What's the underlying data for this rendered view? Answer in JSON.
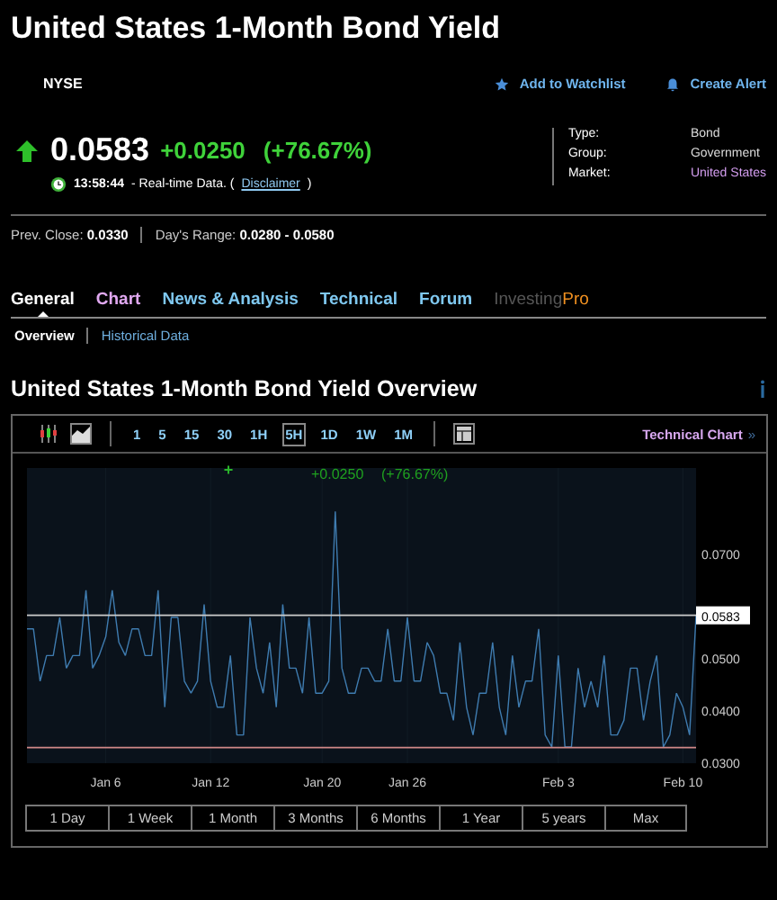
{
  "header": {
    "title": "United States 1-Month Bond Yield",
    "exchange": "NYSE",
    "actions": [
      {
        "kind": "watchlist",
        "label": "Add to Watchlist"
      },
      {
        "kind": "alert",
        "label": "Create Alert"
      }
    ]
  },
  "quote": {
    "price": "0.0583",
    "change": "+0.0250",
    "change_pct": "(+76.67%)",
    "time": "13:58:44",
    "status": "- Real-time Data. (",
    "disclaimer": "Disclaimer",
    "status_end": ")"
  },
  "info": [
    {
      "label": "Type:",
      "value": "Bond",
      "kind": "plain"
    },
    {
      "label": "Group:",
      "value": "Government",
      "kind": "plain"
    },
    {
      "label": "Market:",
      "value": "United States",
      "kind": "link"
    }
  ],
  "stats": [
    {
      "label": "Prev. Close:",
      "value": "0.0330"
    },
    {
      "label": "Day's Range:",
      "value": "0.0280 - 0.0580"
    }
  ],
  "tabs": [
    {
      "label": "General",
      "kind": "plain",
      "selected": true
    },
    {
      "label": "Chart",
      "kind": "chart",
      "selected": false
    },
    {
      "label": "News & Analysis",
      "kind": "plain",
      "selected": false
    },
    {
      "label": "Technical",
      "kind": "plain",
      "selected": false
    },
    {
      "label": "Forum",
      "kind": "plain",
      "selected": false
    },
    {
      "label": "Investing",
      "suffix": "Pro",
      "kind": "pro",
      "selected": false
    }
  ],
  "subtabs": [
    {
      "label": "Overview",
      "selected": true
    },
    {
      "label": "Historical Data",
      "selected": false
    }
  ],
  "overview": {
    "title": "United States 1-Month Bond Yield Overview",
    "toolbar": {
      "styles": [
        {
          "kind": "candles",
          "selected": false
        },
        {
          "kind": "area",
          "selected": true
        }
      ],
      "intervals": [
        {
          "label": "1",
          "selected": false
        },
        {
          "label": "5",
          "selected": false
        },
        {
          "label": "15",
          "selected": false
        },
        {
          "label": "30",
          "selected": false
        },
        {
          "label": "1H",
          "selected": false
        },
        {
          "label": "5H",
          "selected": true
        },
        {
          "label": "1D",
          "selected": false
        },
        {
          "label": "1W",
          "selected": false
        },
        {
          "label": "1M",
          "selected": false
        }
      ],
      "link": "Technical Chart",
      "link_arrow": "»"
    },
    "chart_header": {
      "marker": "+",
      "change": "+0.0250",
      "change_pct": "(+76.67%)"
    },
    "chart_data": {
      "type": "line",
      "ylim": [
        0.03,
        0.0865
      ],
      "yticks": [
        {
          "value": 0.03,
          "label": "0.0300"
        },
        {
          "value": 0.04,
          "label": "0.0400"
        },
        {
          "value": 0.05,
          "label": "0.0500"
        },
        {
          "value": 0.07,
          "label": "0.0700"
        }
      ],
      "categories": [
        null,
        null,
        null,
        null,
        null,
        null,
        null,
        null,
        null,
        null,
        null,
        null,
        "Jan 6",
        null,
        null,
        null,
        null,
        null,
        null,
        null,
        null,
        null,
        null,
        null,
        null,
        null,
        null,
        null,
        "Jan 12",
        null,
        null,
        null,
        null,
        null,
        null,
        null,
        null,
        null,
        null,
        null,
        null,
        null,
        null,
        null,
        null,
        "Jan 20",
        null,
        null,
        null,
        null,
        null,
        null,
        null,
        null,
        null,
        null,
        null,
        null,
        "Jan 26",
        null,
        null,
        null,
        null,
        null,
        null,
        null,
        null,
        null,
        null,
        null,
        null,
        null,
        null,
        null,
        null,
        null,
        null,
        null,
        null,
        null,
        null,
        "Feb 3",
        null,
        null,
        null,
        null,
        null,
        null,
        null,
        null,
        null,
        null,
        null,
        null,
        null,
        null,
        null,
        null,
        null,
        null,
        "Feb 10",
        null,
        null
      ],
      "series": [
        {
          "color": "#3f7cb0",
          "values": [
            0.0557,
            0.0557,
            0.0457,
            0.0506,
            0.0506,
            0.0579,
            0.0482,
            0.0506,
            0.0506,
            0.0631,
            0.0482,
            0.0506,
            0.0542,
            0.0631,
            0.0531,
            0.0506,
            0.0557,
            0.0557,
            0.0506,
            0.0506,
            0.0631,
            0.0407,
            0.0579,
            0.0579,
            0.0457,
            0.0434,
            0.0457,
            0.0604,
            0.0457,
            0.0407,
            0.0407,
            0.0506,
            0.0354,
            0.0354,
            0.0579,
            0.0482,
            0.0434,
            0.0531,
            0.0407,
            0.0604,
            0.0482,
            0.0482,
            0.0434,
            0.0579,
            0.0434,
            0.0434,
            0.0457,
            0.0782,
            0.0482,
            0.0434,
            0.0434,
            0.0482,
            0.0482,
            0.0457,
            0.0457,
            0.0557,
            0.0457,
            0.0457,
            0.0579,
            0.0457,
            0.0457,
            0.0531,
            0.0506,
            0.0434,
            0.0434,
            0.0382,
            0.0531,
            0.0407,
            0.0354,
            0.0434,
            0.0434,
            0.0531,
            0.0407,
            0.0354,
            0.0506,
            0.0407,
            0.0457,
            0.0457,
            0.0557,
            0.0354,
            0.0331,
            0.0506,
            0.0331,
            0.0331,
            0.0482,
            0.0407,
            0.0457,
            0.0407,
            0.0506,
            0.0354,
            0.0354,
            0.0382,
            0.0482,
            0.0482,
            0.0382,
            0.0457,
            0.0506,
            0.0331,
            0.0354,
            0.0434,
            0.0407,
            0.0354,
            0.0583
          ]
        }
      ],
      "grid": true,
      "ref_lines": [
        {
          "axis": "y",
          "value": 0.0583,
          "label": "0.0583",
          "color": "#cccccc"
        },
        {
          "axis": "y",
          "value": 0.033,
          "color": "#d08888"
        }
      ]
    },
    "ranges": [
      {
        "label": "1 Day",
        "selected": false
      },
      {
        "label": "1 Week",
        "selected": false
      },
      {
        "label": "1 Month",
        "selected": false
      },
      {
        "label": "3 Months",
        "selected": false
      },
      {
        "label": "6 Months",
        "selected": false
      },
      {
        "label": "1 Year",
        "selected": false
      },
      {
        "label": "5 years",
        "selected": false
      },
      {
        "label": "Max",
        "selected": false
      }
    ]
  }
}
